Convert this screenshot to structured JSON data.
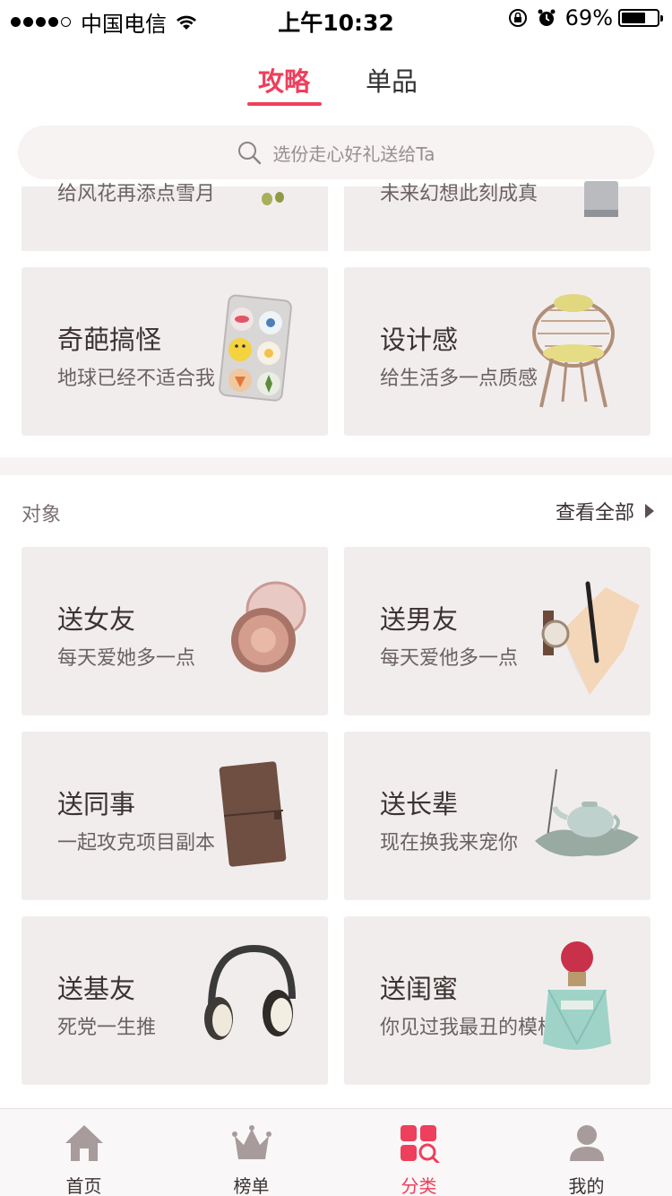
{
  "status_bar": {
    "carrier": "中国电信",
    "time": "上午10:32",
    "battery": "69%",
    "battery_level": 0.69
  },
  "top_tabs": [
    {
      "label": "攻略",
      "active": true
    },
    {
      "label": "单品",
      "active": false
    }
  ],
  "search": {
    "placeholder": "选份走心好礼送给Ta",
    "icon": "search-icon"
  },
  "partial_cards": [
    {
      "subtitle": "给风花再添点雪月"
    },
    {
      "subtitle": "未来幻想此刻成真"
    }
  ],
  "style_cards": [
    {
      "title": "奇葩搞怪",
      "subtitle": "地球已经不适合我",
      "icon": "pill-pack-icon"
    },
    {
      "title": "设计感",
      "subtitle": "给生活多一点质感",
      "icon": "chair-icon"
    }
  ],
  "recipient_section": {
    "title": "对象",
    "see_all": "查看全部",
    "cards": [
      {
        "title": "送女友",
        "subtitle": "每天爱她多一点",
        "icon": "compact-mirror-icon"
      },
      {
        "title": "送男友",
        "subtitle": "每天爱他多一点",
        "icon": "watch-pen-icon"
      },
      {
        "title": "送同事",
        "subtitle": "一起攻克项目副本",
        "icon": "notebook-icon"
      },
      {
        "title": "送长辈",
        "subtitle": "现在换我来宠你",
        "icon": "teapot-icon"
      },
      {
        "title": "送基友",
        "subtitle": "死党一生推",
        "icon": "headphones-icon"
      },
      {
        "title": "送闺蜜",
        "subtitle": "你见过我最丑的模样",
        "icon": "perfume-icon"
      }
    ]
  },
  "tab_bar": [
    {
      "label": "首页",
      "icon": "home-icon",
      "active": false
    },
    {
      "label": "榜单",
      "icon": "crown-icon",
      "active": false
    },
    {
      "label": "分类",
      "icon": "category-search-icon",
      "active": true
    },
    {
      "label": "我的",
      "icon": "profile-icon",
      "active": false
    }
  ],
  "colors": {
    "accent": "#ee3f5c",
    "card_bg": "#f2eded",
    "icon_gray": "#a89b9b"
  }
}
